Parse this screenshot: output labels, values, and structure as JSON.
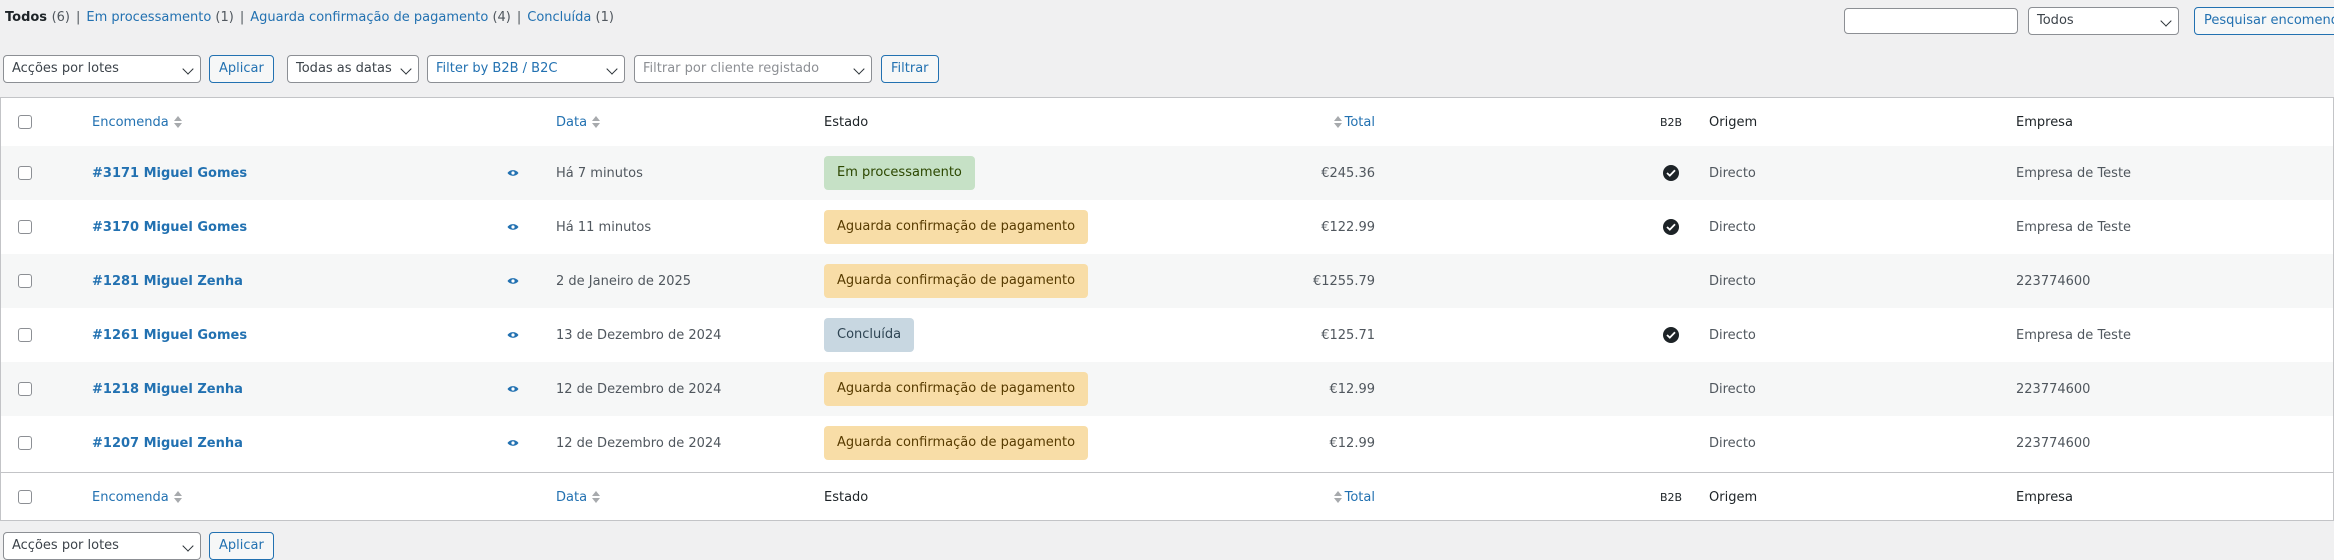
{
  "status_filters": [
    {
      "label": "Todos",
      "count": "(6)",
      "current": true
    },
    {
      "label": "Em processamento",
      "count": "(1)",
      "current": false
    },
    {
      "label": "Aguarda confirmação de pagamento",
      "count": "(4)",
      "current": false
    },
    {
      "label": "Concluída",
      "count": "(1)",
      "current": false
    }
  ],
  "search": {
    "input_value": "",
    "status_select": "Todos",
    "button_label": "Pesquisar encomendas"
  },
  "filters": {
    "bulk_actions": "Acções por lotes",
    "apply_label": "Aplicar",
    "date_select": "Todas as datas",
    "b2b_select": "Filter by B2B / B2C",
    "customer_placeholder": "Filtrar por cliente registado",
    "filter_label": "Filtrar"
  },
  "columns": {
    "order": "Encomenda",
    "date": "Data",
    "status": "Estado",
    "total": "Total",
    "b2b": "B2B",
    "origin": "Origem",
    "company": "Empresa"
  },
  "orders": [
    {
      "order": "#3171 Miguel Gomes",
      "date": "Há 7 minutos",
      "status": "Em processamento",
      "status_type": "processing",
      "total": "€245.36",
      "b2b": true,
      "origin": "Directo",
      "company": "Empresa de Teste"
    },
    {
      "order": "#3170 Miguel Gomes",
      "date": "Há 11 minutos",
      "status": "Aguarda confirmação de pagamento",
      "status_type": "awaiting",
      "total": "€122.99",
      "b2b": true,
      "origin": "Directo",
      "company": "Empresa de Teste"
    },
    {
      "order": "#1281 Miguel Zenha",
      "date": "2 de Janeiro de 2025",
      "status": "Aguarda confirmação de pagamento",
      "status_type": "awaiting",
      "total": "€1255.79",
      "b2b": false,
      "origin": "Directo",
      "company": "223774600"
    },
    {
      "order": "#1261 Miguel Gomes",
      "date": "13 de Dezembro de 2024",
      "status": "Concluída",
      "status_type": "completed",
      "total": "€125.71",
      "b2b": true,
      "origin": "Directo",
      "company": "Empresa de Teste"
    },
    {
      "order": "#1218 Miguel Zenha",
      "date": "12 de Dezembro de 2024",
      "status": "Aguarda confirmação de pagamento",
      "status_type": "awaiting",
      "total": "€12.99",
      "b2b": false,
      "origin": "Directo",
      "company": "223774600"
    },
    {
      "order": "#1207 Miguel Zenha",
      "date": "12 de Dezembro de 2024",
      "status": "Aguarda confirmação de pagamento",
      "status_type": "awaiting",
      "total": "€12.99",
      "b2b": false,
      "origin": "Directo",
      "company": "223774600"
    }
  ],
  "bottom_bar": {
    "bulk_actions": "Acções por lotes",
    "apply_label": "Aplicar"
  },
  "icons": {
    "preview": "eye-icon",
    "b2b_flag": "check-circle-icon",
    "sort": "sort-arrows-icon"
  },
  "colors": {
    "link": "#2271b1",
    "processing_bg": "#c6e1c6",
    "awaiting_bg": "#f8dda7",
    "completed_bg": "#c8d7e1"
  }
}
